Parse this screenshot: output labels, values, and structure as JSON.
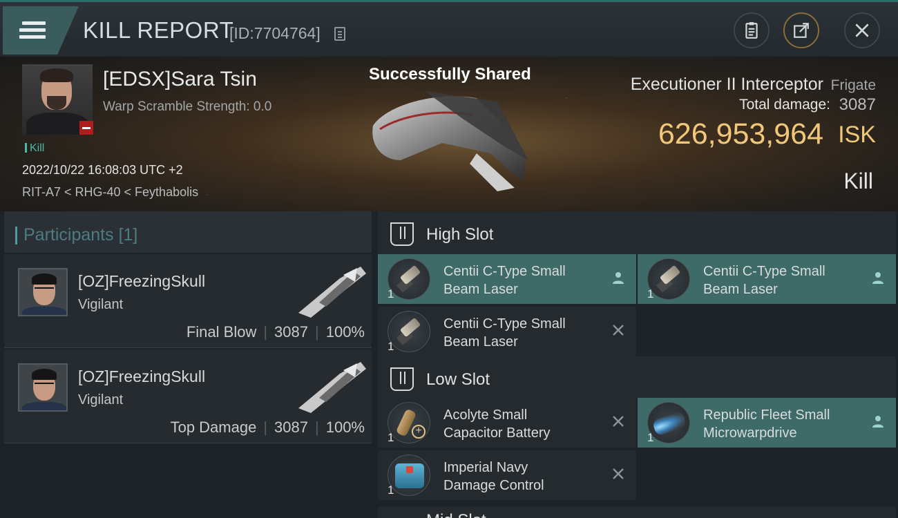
{
  "header": {
    "title": "KILL REPORT",
    "report_id": "[ID:7704764]",
    "icons": [
      "menu-icon",
      "copy-icon",
      "clipboard-icon",
      "share-icon",
      "close-icon"
    ]
  },
  "victim": {
    "name": "[EDSX]Sara Tsin",
    "warp_scramble": "Warp Scramble Strength: 0.0",
    "tag": "Kill",
    "datetime": "2022/10/22 16:08:03 UTC +2",
    "location": "RIT-A7 < RHG-40 < Feythabolis",
    "shared_notice": "Successfully Shared",
    "ship_name": "Executioner II Interceptor",
    "ship_class": "Frigate",
    "damage_label": "Total damage:",
    "damage_value": "3087",
    "isk_value": "626,953,964",
    "isk_unit": "ISK",
    "result": "Kill"
  },
  "participants": {
    "title": "Participants",
    "count": "[1]",
    "rows": [
      {
        "name": "[OZ]FreezingSkull",
        "ship": "Vigilant",
        "role": "Final Blow",
        "damage": "3087",
        "percent": "100%"
      },
      {
        "name": "[OZ]FreezingSkull",
        "ship": "Vigilant",
        "role": "Top Damage",
        "damage": "3087",
        "percent": "100%"
      }
    ]
  },
  "fittings": {
    "high_slot": {
      "label": "High Slot",
      "modules": [
        {
          "name_line1": "Centii C-Type Small",
          "name_line2": "Beam Laser",
          "qty": "1",
          "status": "person-icon"
        },
        {
          "name_line1": "Centii C-Type Small",
          "name_line2": "Beam Laser",
          "qty": "1",
          "status": "person-icon"
        },
        {
          "name_line1": "Centii C-Type Small",
          "name_line2": "Beam Laser",
          "qty": "1",
          "status": "destroyed-x-icon"
        }
      ]
    },
    "low_slot": {
      "label": "Low Slot",
      "modules": [
        {
          "name_line1": "Acolyte Small",
          "name_line2": "Capacitor Battery",
          "qty": "1",
          "status": "destroyed-x-icon"
        },
        {
          "name_line1": "Republic Fleet Small",
          "name_line2": "Microwarpdrive",
          "qty": "1",
          "status": "person-icon"
        },
        {
          "name_line1": "Imperial Navy",
          "name_line2": "Damage Control",
          "qty": "1",
          "status": "destroyed-x-icon"
        }
      ]
    },
    "next_slot_label": "Mid Slot"
  },
  "colors": {
    "accent_teal": "#4fb7a8",
    "isk_gold": "#f1c87a",
    "active_module_bg": "#3e6a67",
    "loss_badge_red": "#b01d1d"
  }
}
